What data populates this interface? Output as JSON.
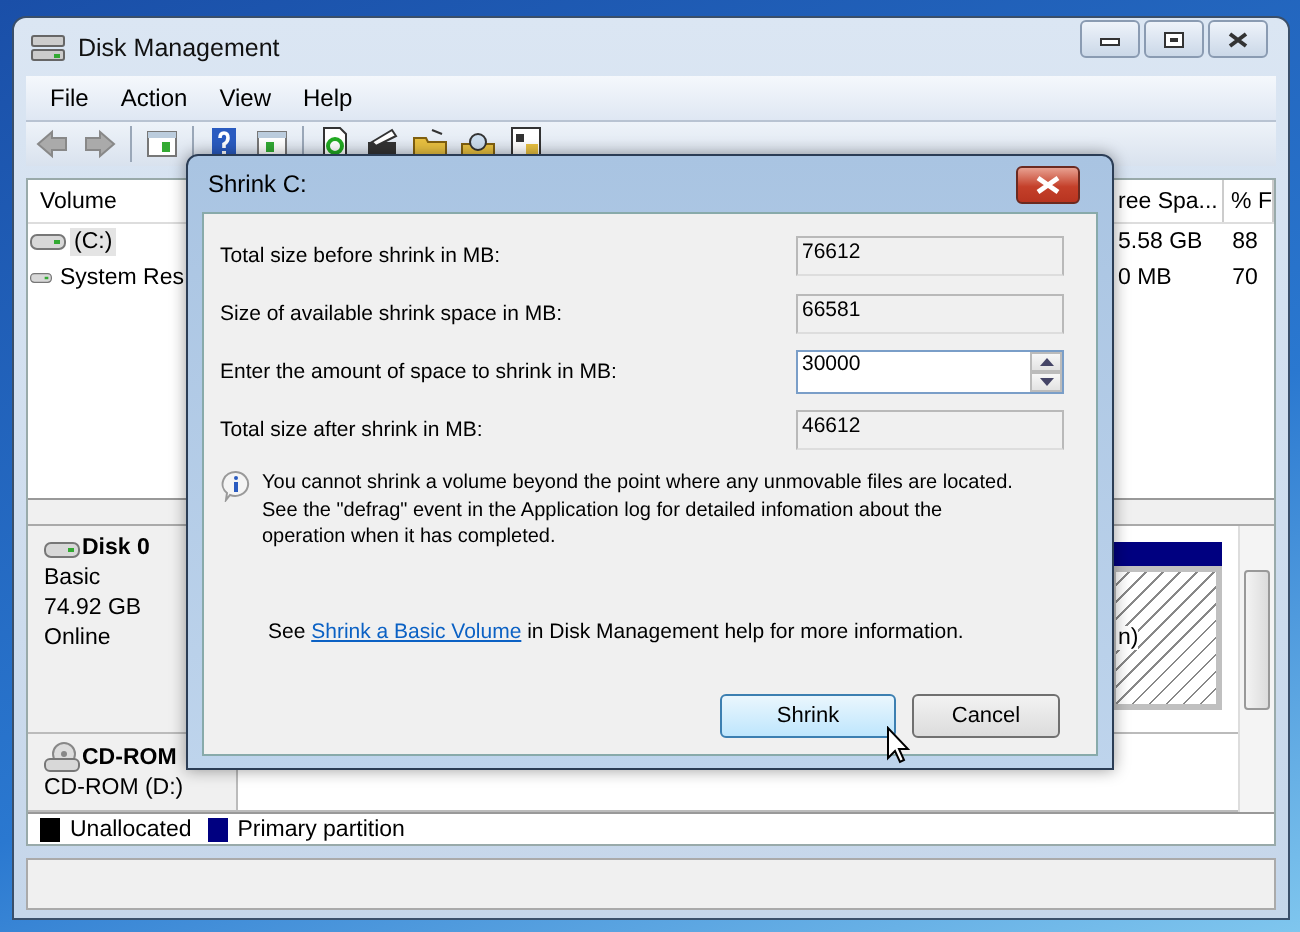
{
  "window": {
    "title": "Disk Management"
  },
  "menu": [
    {
      "label": "File"
    },
    {
      "label": "Action"
    },
    {
      "label": "View"
    },
    {
      "label": "Help"
    }
  ],
  "volumes": {
    "columns": [
      "Volume",
      "ree Spa...",
      "% F"
    ],
    "rows": [
      {
        "volume": "(C:)",
        "free": "5.58 GB",
        "percent": "88",
        "selected": true
      },
      {
        "volume": "System Res",
        "free": "0 MB",
        "percent": "70",
        "selected": false
      }
    ]
  },
  "disks": [
    {
      "kind": "disk",
      "name": "Disk 0",
      "lines": [
        "Basic",
        "74.92 GB",
        "Online"
      ],
      "partition": "n)"
    },
    {
      "kind": "cdrom",
      "name": "CD-ROM",
      "lines": [
        "CD-ROM (D:)"
      ]
    }
  ],
  "legend": [
    {
      "label": "Unallocated",
      "color": "#000000"
    },
    {
      "label": "Primary partition",
      "color": "#000080"
    }
  ],
  "dialog": {
    "title": "Shrink C:",
    "fields": [
      {
        "kind": "readonly",
        "label": "Total size before shrink in MB:",
        "value": "76612"
      },
      {
        "kind": "readonly",
        "label": "Size of available shrink space in MB:",
        "value": "66581"
      },
      {
        "kind": "spin",
        "label": "Enter the amount of space to shrink in MB:",
        "value": "30000"
      },
      {
        "kind": "readonly",
        "label": "Total size after shrink in MB:",
        "value": "46612"
      }
    ],
    "note": [
      "You cannot shrink a volume beyond the point where any unmovable files are located.",
      "See the \"defrag\" event in the Application log for detailed infomation about the",
      "operation when it has completed."
    ],
    "help": {
      "before": "See ",
      "link": "Shrink a Basic Volume",
      "after": " in Disk Management help for more information."
    },
    "buttons": [
      {
        "label": "Shrink",
        "default": true
      },
      {
        "label": "Cancel",
        "default": false
      }
    ]
  }
}
